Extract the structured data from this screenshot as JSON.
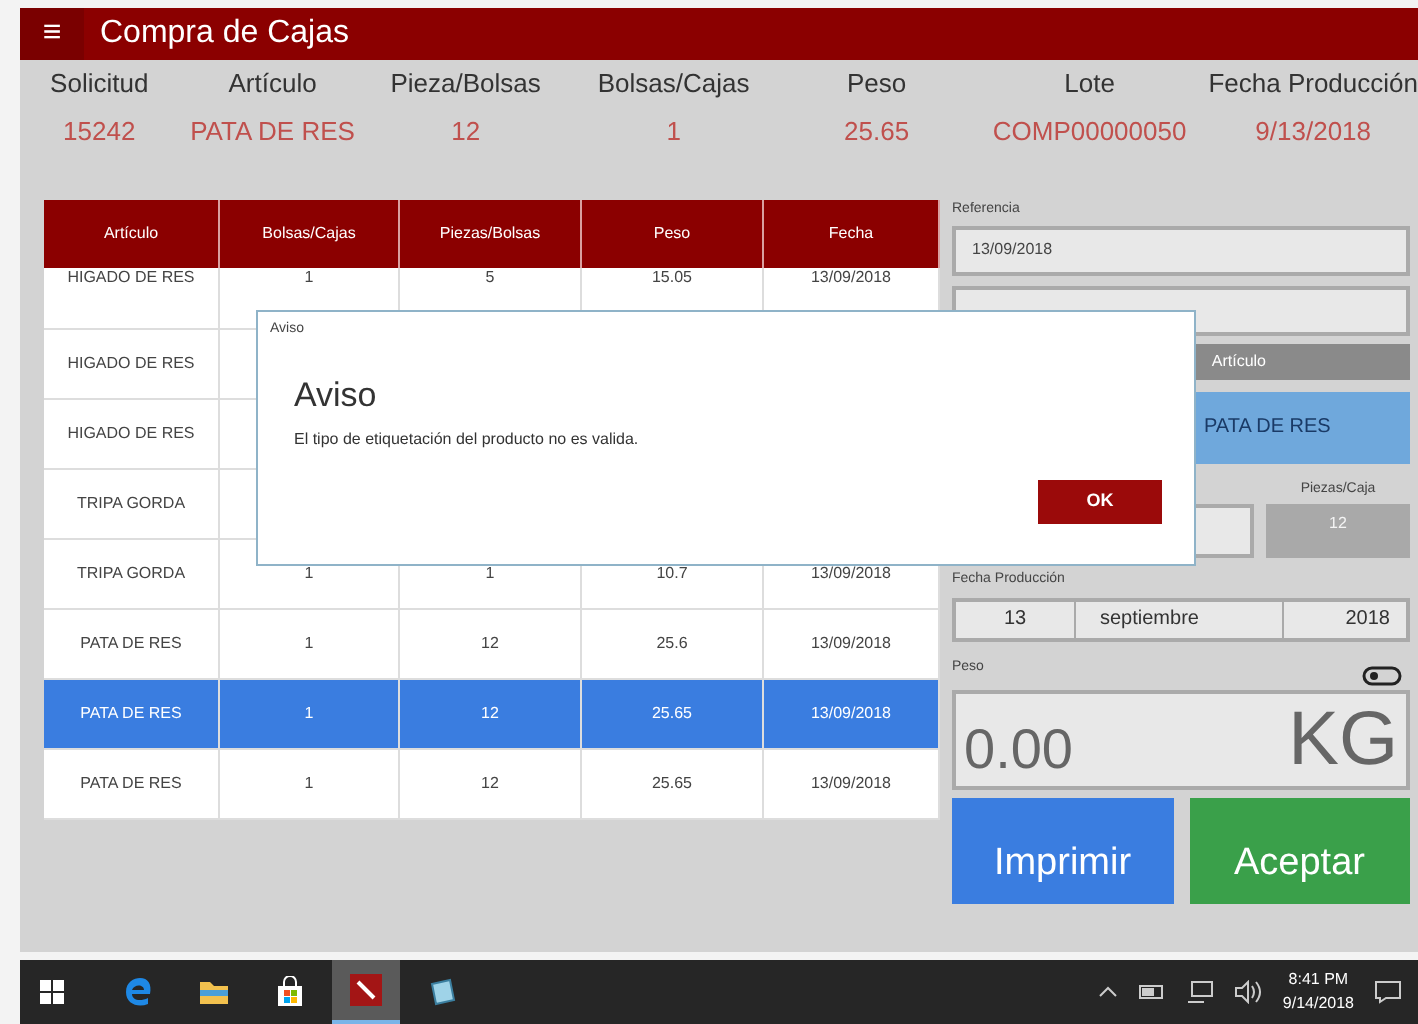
{
  "window": {
    "title": "Compra de Cajas",
    "menu_icon": "≡"
  },
  "summary": [
    {
      "label": "Solicitud",
      "value": "15242"
    },
    {
      "label": "Artículo",
      "value": "PATA DE RES"
    },
    {
      "label": "Pieza/Bolsas",
      "value": "12"
    },
    {
      "label": "Bolsas/Cajas",
      "value": "1"
    },
    {
      "label": "Peso",
      "value": "25.65"
    },
    {
      "label": "Lote",
      "value": "COMP00000050"
    },
    {
      "label": "Fecha Producción",
      "value": "9/13/2018"
    }
  ],
  "table": {
    "columns": [
      "Artículo",
      "Bolsas/Cajas",
      "Piezas/Bolsas",
      "Peso",
      "Fecha"
    ],
    "rows": [
      {
        "cells": [
          "HIGADO DE RES",
          "1",
          "5",
          "15.05",
          "13/09/2018"
        ],
        "selected": false,
        "partial": true
      },
      {
        "cells": [
          "HIGADO DE RES"
        ],
        "selected": false
      },
      {
        "cells": [
          "HIGADO DE RES"
        ],
        "selected": false
      },
      {
        "cells": [
          "TRIPA GORDA"
        ],
        "selected": false
      },
      {
        "cells": [
          "TRIPA GORDA",
          "1",
          "1",
          "10.7",
          "13/09/2018"
        ],
        "selected": false
      },
      {
        "cells": [
          "PATA DE RES",
          "1",
          "12",
          "25.6",
          "13/09/2018"
        ],
        "selected": false
      },
      {
        "cells": [
          "PATA DE RES",
          "1",
          "12",
          "25.65",
          "13/09/2018"
        ],
        "selected": true
      },
      {
        "cells": [
          "PATA DE RES",
          "1",
          "12",
          "25.65",
          "13/09/2018"
        ],
        "selected": false
      }
    ]
  },
  "side": {
    "referencia": {
      "label": "Referencia",
      "value": "13/09/2018"
    },
    "articulo": {
      "header": "Artículo",
      "value": "PATA DE RES"
    },
    "piezas": {
      "label": "Piezas/Caja",
      "value": "12"
    },
    "fecha": {
      "label": "Fecha Producción",
      "day": "13",
      "month": "septiembre",
      "year": "2018"
    },
    "peso": {
      "label": "Peso",
      "value": "0.00",
      "unit": "KG"
    },
    "buttons": [
      {
        "label": "Imprimir",
        "color": "#3a7de0"
      },
      {
        "label": "Aceptar",
        "color": "#3aa04a"
      }
    ]
  },
  "dialog": {
    "caption": "Aviso",
    "title": "Aviso",
    "message": "El tipo de etiquetación del producto no es valida.",
    "button": "OK"
  },
  "taskbar": {
    "apps": [
      {
        "kind": "edge",
        "selected": false
      },
      {
        "kind": "folder",
        "selected": false
      },
      {
        "kind": "store",
        "selected": false
      },
      {
        "kind": "app",
        "selected": true
      },
      {
        "kind": "notes",
        "selected": false
      }
    ],
    "time": "8:41 PM",
    "date": "9/14/2018"
  }
}
